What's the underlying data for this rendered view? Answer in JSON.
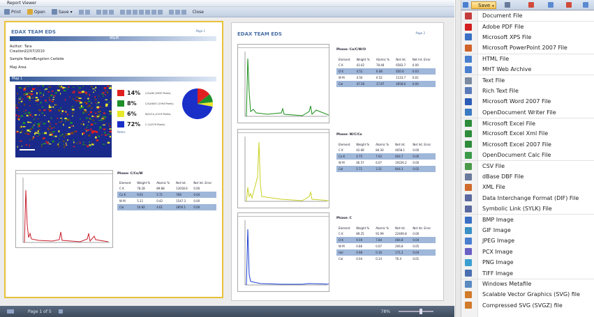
{
  "viewer": {
    "title": "Report Viewer",
    "toolbar": {
      "print": "Print",
      "open": "Open",
      "save": "Save",
      "close": "Close"
    },
    "status": {
      "page": "Page 1 of 5",
      "zoom": "78%"
    }
  },
  "page1": {
    "header": "EDAX TEAM EDS",
    "page_no": "Page 1",
    "band_title": "M&M",
    "author_label": "Author:",
    "author": "Tara",
    "creation_label": "Creation:",
    "creation": "22/07/2010",
    "sample_label": "Sample Name:",
    "sample": "Tungsten Carbide",
    "maparea": "Map Area",
    "map1": "Map 1",
    "legend": [
      {
        "pct": "14%",
        "label": "C/Co/W (2632 Pixels)",
        "color": "#e02020"
      },
      {
        "pct": "8%",
        "label": "C/Co/W/O (1594 Pixels)",
        "color": "#1d8f2a"
      },
      {
        "pct": "6%",
        "label": "W/C/Co (1219 Pixels)",
        "color": "#e8e82a"
      },
      {
        "pct": "72%",
        "label": "C (14379 Pixels)",
        "color": "#1a2fc8"
      }
    ],
    "notes": "Notes",
    "phase_label": "Phase:",
    "phase": "C/Co/W",
    "table_head": [
      "Element",
      "Weight %",
      "Atomic %",
      "Net Int.",
      "Net Int. Error"
    ],
    "table": [
      [
        "C K",
        "78.28",
        "89.88",
        "13018.6",
        "0.00"
      ],
      [
        "Co K",
        "9.61",
        "5.71",
        "768",
        "0.04"
      ],
      [
        "W M",
        "5.11",
        "0.42",
        "1547.3",
        "0.00"
      ],
      [
        "Cal",
        "10.82",
        "4.61",
        "2850.1",
        "0.00"
      ]
    ]
  },
  "page2": {
    "header": "EDAX TEAM EDS",
    "page_no": "Page 2",
    "blocks": [
      {
        "phase": "Co/C/W/O",
        "rows": [
          [
            "C K",
            "43.42",
            "78.48",
            "6583.7",
            "0.00"
          ],
          [
            "O K",
            "4.51",
            "6.08",
            "650.6",
            "0.03"
          ],
          [
            "W M",
            "4.50",
            "0.52",
            "1133.7",
            "0.01"
          ],
          [
            "Cal",
            "47.58",
            "17.87",
            "4058.6",
            "0.00"
          ]
        ],
        "color": "#1a8f1a"
      },
      {
        "phase": "W/C/Co",
        "rows": [
          [
            "C K",
            "42.68",
            "84.30",
            "4658.1",
            "0.00"
          ],
          [
            "Co K",
            "4.75",
            "7.63",
            "604.7",
            "0.00"
          ],
          [
            "W M",
            "46.57",
            "6.07",
            "19226.2",
            "0.00"
          ],
          [
            "Cal",
            "5.71",
            "3.31",
            "844.3",
            "0.02"
          ]
        ],
        "color": "#c8d020"
      },
      {
        "phase": "C",
        "rows": [
          [
            "C K",
            "89.25",
            "91.99",
            "22409.8",
            "0.00"
          ],
          [
            "O K",
            "9.59",
            "7.84",
            "484.8",
            "0.04"
          ],
          [
            "W M",
            "0.86",
            "0.07",
            "206.8",
            "0.05"
          ],
          [
            "Hal",
            "0.98",
            "0.16",
            "171.2",
            "0.04"
          ],
          [
            "Cal",
            "0.04",
            "0.14",
            "76.4",
            "0.01"
          ]
        ],
        "color": "#1a3fd0"
      }
    ],
    "table_head": [
      "Element",
      "Weight %",
      "Atomic %",
      "Net Int.",
      "Net Int. Error"
    ]
  },
  "menu": {
    "save": "Save",
    "items": [
      {
        "label": "Document File",
        "color": "#c43c3c",
        "sep": false
      },
      {
        "label": "Adobe PDF File",
        "color": "#d21f1f",
        "sep": true
      },
      {
        "label": "Microsoft XPS File",
        "color": "#3a6fc4",
        "sep": false
      },
      {
        "label": "Microsoft PowerPoint 2007 File",
        "color": "#d0632a",
        "sep": false
      },
      {
        "label": "HTML File",
        "color": "#4a7fd0",
        "sep": true
      },
      {
        "label": "MHT Web Archive",
        "color": "#4a7fd0",
        "sep": false
      },
      {
        "label": "Text File",
        "color": "#7a8aa0",
        "sep": true
      },
      {
        "label": "Rich Text File",
        "color": "#5a7ab8",
        "sep": false
      },
      {
        "label": "Microsoft Word 2007 File",
        "color": "#2b5cb8",
        "sep": false
      },
      {
        "label": "OpenDocument Writer File",
        "color": "#3a7ac0",
        "sep": false
      },
      {
        "label": "Microsoft Excel File",
        "color": "#2e8b3a",
        "sep": true
      },
      {
        "label": "Microsoft Excel Xml File",
        "color": "#2e8b3a",
        "sep": false
      },
      {
        "label": "Microsoft Excel 2007 File",
        "color": "#2e8b3a",
        "sep": false
      },
      {
        "label": "OpenDocument Calc File",
        "color": "#3a9a4a",
        "sep": false
      },
      {
        "label": "CSV File",
        "color": "#4a9a4a",
        "sep": true
      },
      {
        "label": "dBase DBF File",
        "color": "#6a7a9a",
        "sep": false
      },
      {
        "label": "XML File",
        "color": "#d06a2a",
        "sep": false
      },
      {
        "label": "Data Interchange Format (DIF) File",
        "color": "#5a6aa0",
        "sep": false
      },
      {
        "label": "Symbolic Link (SYLK) File",
        "color": "#5a6aa0",
        "sep": false
      },
      {
        "label": "BMP Image",
        "color": "#3a6fc4",
        "sep": true
      },
      {
        "label": "GIF Image",
        "color": "#3a8fc4",
        "sep": false
      },
      {
        "label": "JPEG Image",
        "color": "#4a7fd0",
        "sep": false
      },
      {
        "label": "PCX Image",
        "color": "#6a5fc4",
        "sep": false
      },
      {
        "label": "PNG Image",
        "color": "#3a9fd0",
        "sep": false
      },
      {
        "label": "TIFF Image",
        "color": "#4a6fb0",
        "sep": false
      },
      {
        "label": "Windows Metafile",
        "color": "#5a8ac0",
        "sep": true
      },
      {
        "label": "Scalable Vector Graphics (SVG) file",
        "color": "#d07a2a",
        "sep": false
      },
      {
        "label": "Compressed SVG (SVGZ) file",
        "color": "#d07a2a",
        "sep": false
      }
    ]
  }
}
